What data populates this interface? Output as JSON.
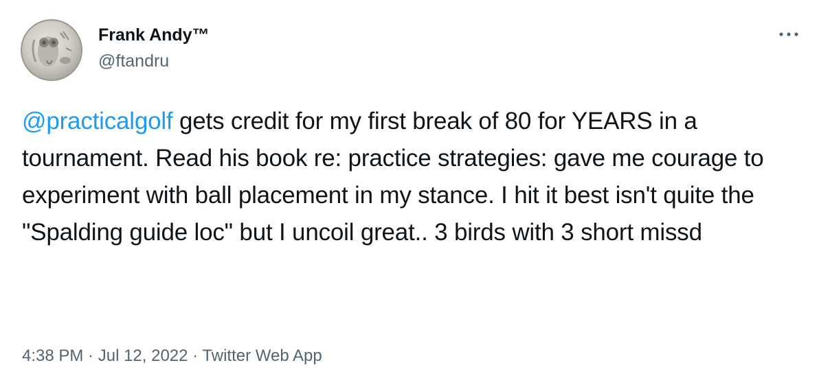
{
  "author": {
    "name": "Frank Andy™",
    "handle": "@ftandru",
    "avatar_icon": "owl-coin-avatar-icon"
  },
  "menu": {
    "icon": "more-options-icon"
  },
  "tweet": {
    "mention": "@practicalgolf",
    "body": " gets credit for my first break of 80 for YEARS in a tournament. Read his book re: practice strategies: gave me courage to experiment with ball placement in my stance. I hit it best isn't quite the \"Spalding guide loc\" but I uncoil great.. 3 birds with 3 short missd"
  },
  "meta": {
    "time": "4:38 PM",
    "sep1": " · ",
    "date": "Jul 12, 2022",
    "sep2": " · ",
    "source": "Twitter Web App"
  },
  "colors": {
    "text": "#0f1419",
    "secondary": "#536471",
    "link": "#1d9bf0"
  }
}
